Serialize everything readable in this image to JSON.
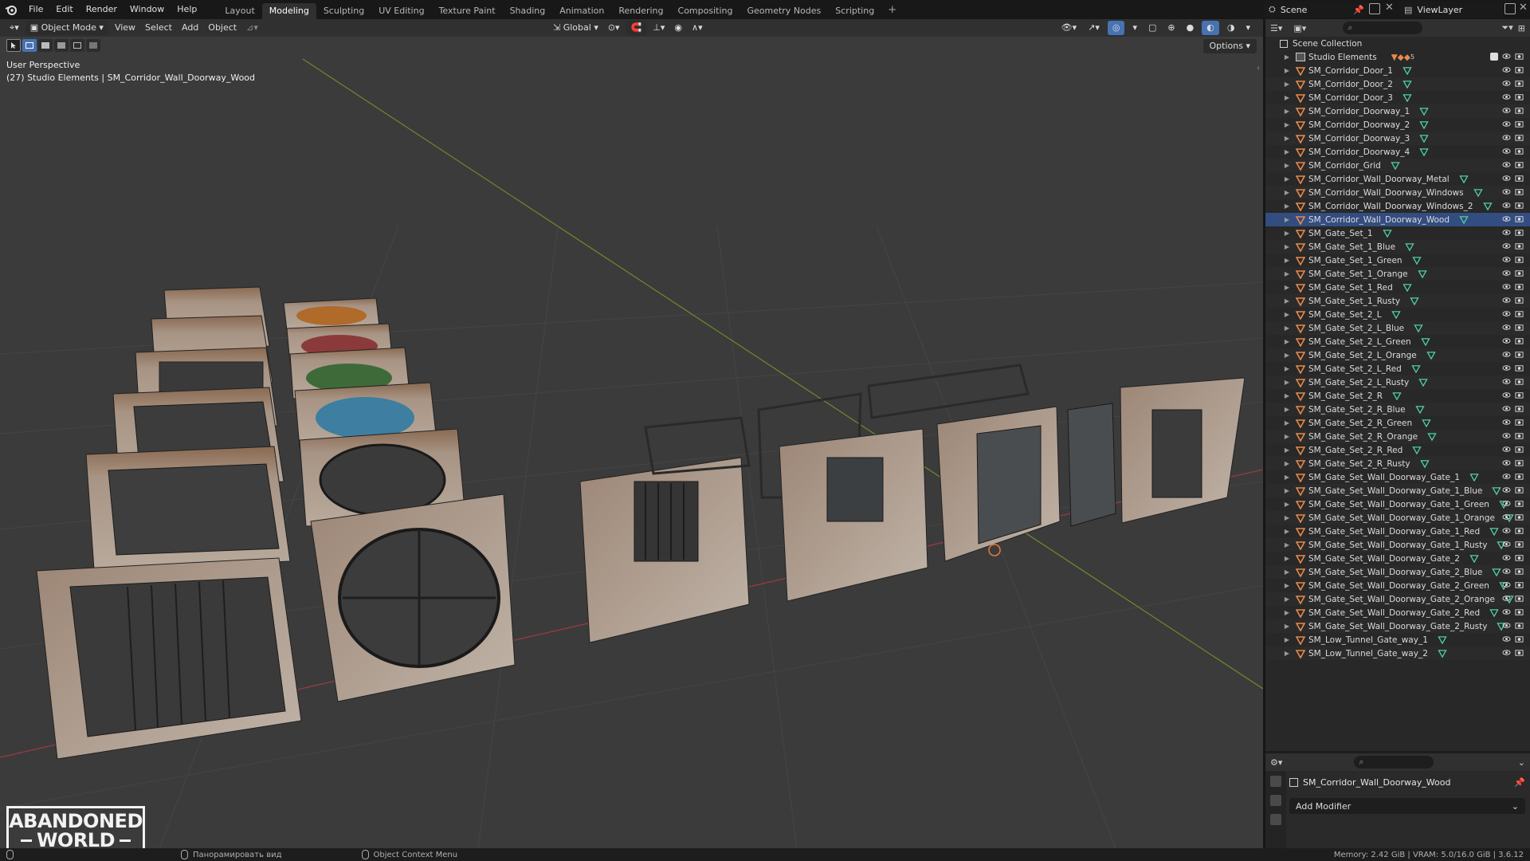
{
  "topbar": {
    "menus": [
      "File",
      "Edit",
      "Render",
      "Window",
      "Help"
    ],
    "workspaces": [
      "Layout",
      "Modeling",
      "Sculpting",
      "UV Editing",
      "Texture Paint",
      "Shading",
      "Animation",
      "Rendering",
      "Compositing",
      "Geometry Nodes",
      "Scripting"
    ],
    "active_workspace": "Modeling",
    "scene_name": "Scene",
    "view_layer": "ViewLayer"
  },
  "viewport": {
    "mode": "Object Mode",
    "menus": [
      "View",
      "Select",
      "Add",
      "Object"
    ],
    "orientation": "Global",
    "options_label": "Options",
    "info_line1": "User Perspective",
    "info_line2": "(27) Studio Elements | SM_Corridor_Wall_Doorway_Wood",
    "watermark_line1": "ABANDONED",
    "watermark_line2": "WORLD"
  },
  "outliner": {
    "root": "Scene Collection",
    "collection": "Studio Elements",
    "collection_count": "5",
    "selected_item": "SM_Corridor_Wall_Doorway_Wood",
    "items": [
      "SM_Corridor_Door_1",
      "SM_Corridor_Door_2",
      "SM_Corridor_Door_3",
      "SM_Corridor_Doorway_1",
      "SM_Corridor_Doorway_2",
      "SM_Corridor_Doorway_3",
      "SM_Corridor_Doorway_4",
      "SM_Corridor_Grid",
      "SM_Corridor_Wall_Doorway_Metal",
      "SM_Corridor_Wall_Doorway_Windows",
      "SM_Corridor_Wall_Doorway_Windows_2",
      "SM_Corridor_Wall_Doorway_Wood",
      "SM_Gate_Set_1",
      "SM_Gate_Set_1_Blue",
      "SM_Gate_Set_1_Green",
      "SM_Gate_Set_1_Orange",
      "SM_Gate_Set_1_Red",
      "SM_Gate_Set_1_Rusty",
      "SM_Gate_Set_2_L",
      "SM_Gate_Set_2_L_Blue",
      "SM_Gate_Set_2_L_Green",
      "SM_Gate_Set_2_L_Orange",
      "SM_Gate_Set_2_L_Red",
      "SM_Gate_Set_2_L_Rusty",
      "SM_Gate_Set_2_R",
      "SM_Gate_Set_2_R_Blue",
      "SM_Gate_Set_2_R_Green",
      "SM_Gate_Set_2_R_Orange",
      "SM_Gate_Set_2_R_Red",
      "SM_Gate_Set_2_R_Rusty",
      "SM_Gate_Set_Wall_Doorway_Gate_1",
      "SM_Gate_Set_Wall_Doorway_Gate_1_Blue",
      "SM_Gate_Set_Wall_Doorway_Gate_1_Green",
      "SM_Gate_Set_Wall_Doorway_Gate_1_Orange",
      "SM_Gate_Set_Wall_Doorway_Gate_1_Red",
      "SM_Gate_Set_Wall_Doorway_Gate_1_Rusty",
      "SM_Gate_Set_Wall_Doorway_Gate_2",
      "SM_Gate_Set_Wall_Doorway_Gate_2_Blue",
      "SM_Gate_Set_Wall_Doorway_Gate_2_Green",
      "SM_Gate_Set_Wall_Doorway_Gate_2_Orange",
      "SM_Gate_Set_Wall_Doorway_Gate_2_Red",
      "SM_Gate_Set_Wall_Doorway_Gate_2_Rusty",
      "SM_Low_Tunnel_Gate_way_1",
      "SM_Low_Tunnel_Gate_way_2"
    ]
  },
  "properties": {
    "object_name": "SM_Corridor_Wall_Doorway_Wood",
    "add_modifier_label": "Add Modifier"
  },
  "statusbar": {
    "pan_hint": "Панорамировать вид",
    "context_hint": "Object Context Menu",
    "stats": "Memory: 2.42 GiB | VRAM: 5.0/16.0 GiB | 3.6.12"
  },
  "colors": {
    "accent": "#4772b3",
    "selected_row": "#334d80",
    "mesh_icon": "#e8894a",
    "data_icon": "#4fd1a0"
  }
}
